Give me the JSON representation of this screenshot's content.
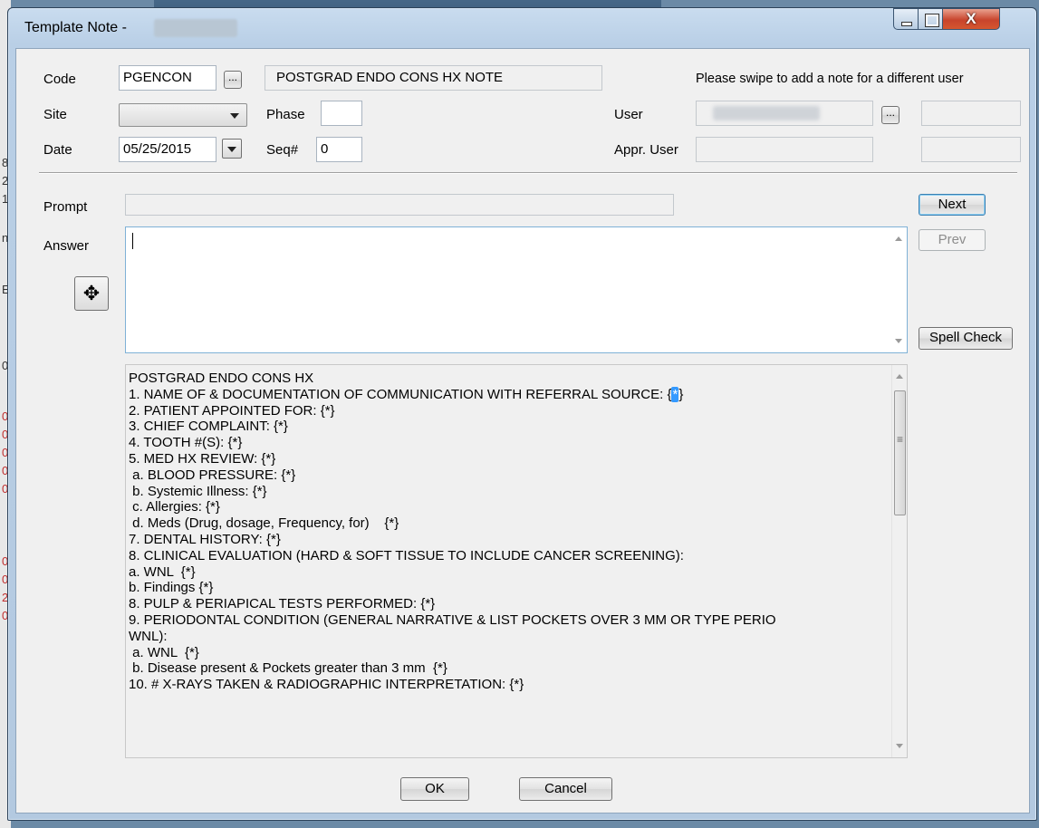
{
  "window": {
    "title": "Template Note -",
    "close_glyph": "X"
  },
  "header": {
    "code_label": "Code",
    "code_value": "PGENCON",
    "lookup_button_label": "...",
    "template_name": "POSTGRAD ENDO CONS HX NOTE",
    "swipe_message": "Please swipe to add a note for a different user",
    "site_label": "Site",
    "site_value": "",
    "phase_label": "Phase",
    "phase_value": "",
    "user_label": "User",
    "user_lookup_label": "...",
    "date_label": "Date",
    "date_value": "05/25/2015",
    "seq_label": "Seq#",
    "seq_value": "0",
    "appr_user_label": "Appr. User"
  },
  "editor": {
    "prompt_label": "Prompt",
    "prompt_value": "",
    "answer_label": "Answer",
    "answer_value": "",
    "next_label": "Next",
    "prev_label": "Prev",
    "spell_check_label": "Spell Check",
    "move_glyph": "✥"
  },
  "template": {
    "lines": [
      "POSTGRAD ENDO CONS HX",
      "1. NAME OF & DOCUMENTATION OF COMMUNICATION WITH REFERRAL SOURCE: {",
      "2. PATIENT APPOINTED FOR: {*}",
      "3. CHIEF COMPLAINT: {*}",
      "4. TOOTH #(S): {*}",
      "5. MED HX REVIEW: {*}",
      " a. BLOOD PRESSURE: {*}",
      " b. Systemic Illness: {*}",
      " c. Allergies: {*}",
      " d. Meds (Drug, dosage, Frequency, for)    {*}",
      "7. DENTAL HISTORY: {*}",
      "8. CLINICAL EVALUATION (HARD & SOFT TISSUE TO INCLUDE CANCER SCREENING):",
      "a. WNL  {*}",
      "b. Findings {*}",
      "8. PULP & PERIAPICAL TESTS PERFORMED: {*}",
      "9. PERIODONTAL CONDITION (GENERAL NARRATIVE & LIST POCKETS OVER 3 MM OR TYPE PERIO",
      "WNL):",
      " a. WNL  {*}",
      " b. Disease present & Pockets greater than 3 mm  {*}",
      "10. # X-RAYS TAKEN & RADIOGRAPHIC INTERPRETATION: {*}"
    ],
    "highlight_token": "*",
    "highlight_close": "}"
  },
  "footer": {
    "ok_label": "OK",
    "cancel_label": "Cancel"
  },
  "background": {
    "edge_chars": [
      "8",
      "2",
      "1",
      "n",
      "E",
      "0",
      "0",
      "0",
      "0",
      "0",
      "0",
      "0",
      "0",
      "2",
      "0"
    ]
  }
}
